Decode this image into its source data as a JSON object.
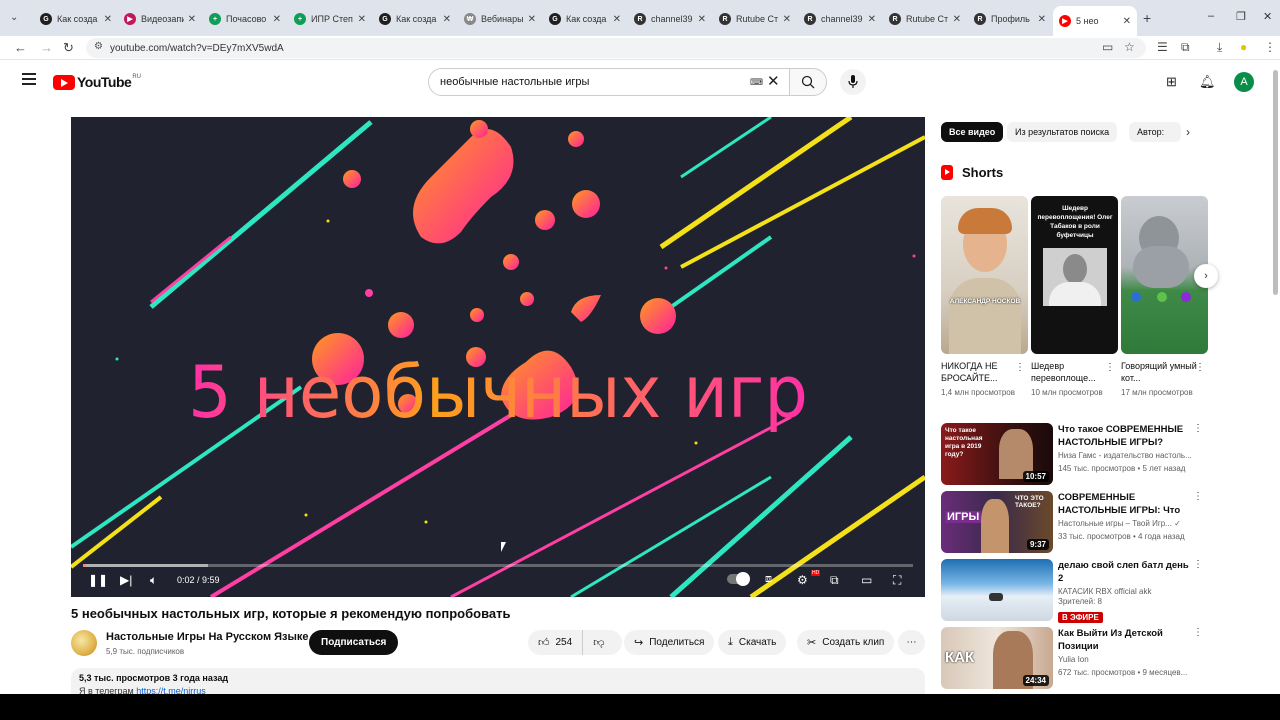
{
  "browser": {
    "tabs": [
      {
        "title": "Как созда",
        "icon": "G",
        "color": "#1f1f1f"
      },
      {
        "title": "Видеозапи",
        "icon": "▶",
        "color": "#c2185b"
      },
      {
        "title": "Почасово",
        "icon": "+",
        "color": "#0f9d58"
      },
      {
        "title": "ИПР Степ",
        "icon": "+",
        "color": "#0f9d58"
      },
      {
        "title": "Как созда",
        "icon": "G",
        "color": "#1f1f1f"
      },
      {
        "title": "Вебинары",
        "icon": "₩",
        "color": "#888888"
      },
      {
        "title": "Как созда",
        "icon": "G",
        "color": "#1f1f1f"
      },
      {
        "title": "channel39",
        "icon": "R",
        "color": "#333333"
      },
      {
        "title": "Rutube Ст",
        "icon": "R",
        "color": "#333333"
      },
      {
        "title": "channel39",
        "icon": "R",
        "color": "#333333"
      },
      {
        "title": "Rutube Ст",
        "icon": "R",
        "color": "#333333"
      },
      {
        "title": "Профиль",
        "icon": "R",
        "color": "#333333"
      },
      {
        "title": "5 нео",
        "icon": "▶",
        "color": "#ff0000"
      }
    ],
    "url": "youtube.com/watch?v=DEy7mXV5wdA"
  },
  "header": {
    "logo_text": "YouTube",
    "region": "RU",
    "search_value": "необычные настольные игры",
    "avatar_letter": "A"
  },
  "player": {
    "overlay_text": "5 необычных игр",
    "time": "0:02 / 9:59",
    "progress": 0.0033,
    "buffered": 0.15,
    "hd_badge": "HD"
  },
  "video": {
    "title": "5 необычных настольных игр, которые я рекомендую попробовать",
    "channel": "Настольные Игры На Русском Языке",
    "subscribers": "5,9 тыс. подписчиков",
    "subscribe_label": "Подписаться",
    "likes": "254",
    "share_label": "Поделиться",
    "download_label": "Скачать",
    "clip_label": "Создать клип",
    "description_meta": "5,3 тыс. просмотров  3 года назад",
    "description_line": "Я в телеграм",
    "description_link": "https://t.me/nirrus"
  },
  "sidebar": {
    "chips": [
      "Все видео",
      "Из результатов поиска",
      "Автор: "
    ],
    "shorts_title": "Shorts",
    "shorts": [
      {
        "title": "НИКОГДА НЕ БРОСАЙТЕ...",
        "views": "1,4 млн просмотров",
        "overlay": "АЛЕКСАНДР НОСКОВ"
      },
      {
        "title": "Шедевр перевоплоще...",
        "views": "10 млн просмотров",
        "overlay": "Шедевр перевоплощения! Олег Табаков в роли буфетчицы"
      },
      {
        "title": "Говорящий умный кот...",
        "views": "17 млн просмотров",
        "overlay": ""
      }
    ],
    "recommendations": [
      {
        "title": "Что такое СОВРЕМЕННЫЕ НАСТОЛЬНЫЕ ИГРЫ?",
        "channel": "Низа Гамс - издательство настоль...",
        "meta": "145 тыс. просмотров • 5 лет назад",
        "duration": "10:57",
        "thumb_text": "Что такое настольная игра в 2019 году?"
      },
      {
        "title": "СОВРЕМЕННЫЕ НАСТОЛЬНЫЕ ИГРЫ: Что эт...",
        "channel": "Настольные игры – Твой Игр... ✓",
        "meta": "33 тыс. просмотров • 4 года назад",
        "duration": "9:37",
        "thumb_text": "ЧТО ЭТО ТАКОЕ?"
      },
      {
        "title": "делаю свой слеп батл день 2",
        "channel": "КАТАСИК RBX official akk",
        "meta": "Зрителей: 8",
        "live": "В ЭФИРЕ",
        "duration": "",
        "thumb_text": ""
      },
      {
        "title": "Как Выйти Из Детской Позиции",
        "channel": "Yulia Ion",
        "meta": "672 тыс. просмотров • 9 месяцев...",
        "duration": "24:34",
        "thumb_text": "КАК"
      }
    ]
  }
}
